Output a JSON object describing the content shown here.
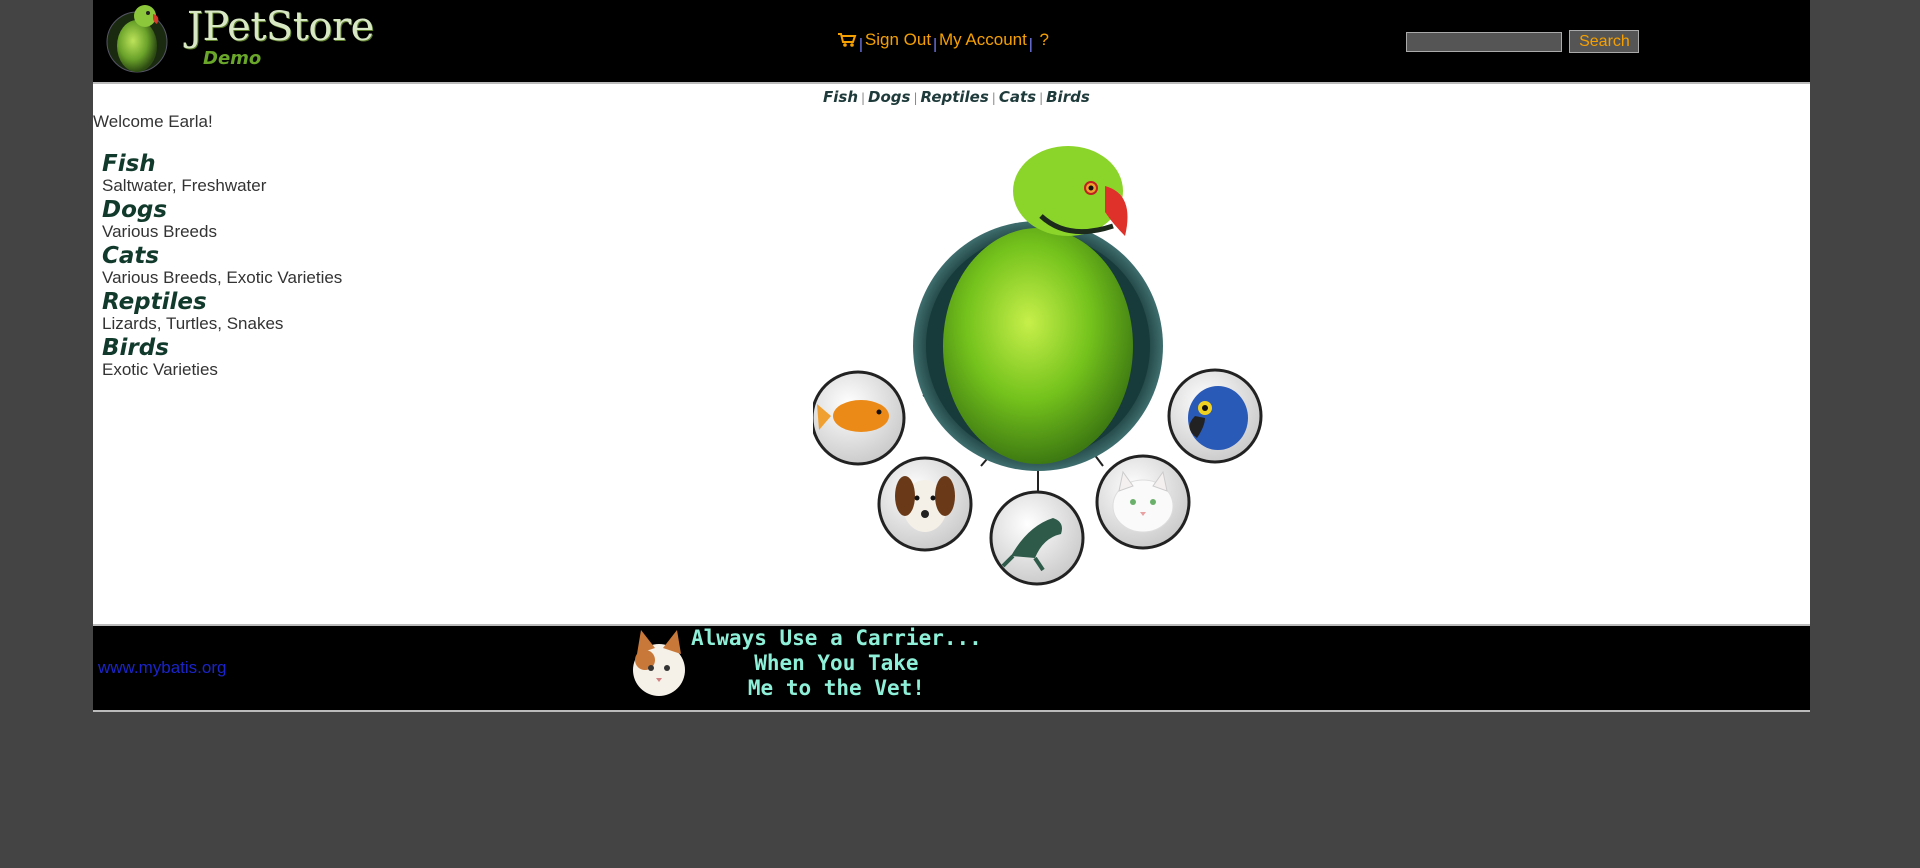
{
  "header": {
    "logo_title": "JPetStore",
    "logo_subtitle": "Demo",
    "menu": {
      "sign_out": "Sign Out",
      "my_account": "My Account",
      "help": "?",
      "separator": "|"
    },
    "search": {
      "placeholder": "",
      "button_label": "Search"
    },
    "colors": {
      "link": "#f5a000",
      "separator": "#7c84ff"
    }
  },
  "quick_links": [
    "Fish",
    "Dogs",
    "Reptiles",
    "Cats",
    "Birds"
  ],
  "quick_links_separator": "|",
  "welcome": "Welcome Earla!",
  "categories": [
    {
      "name": "Fish",
      "description": "Saltwater, Freshwater"
    },
    {
      "name": "Dogs",
      "description": "Various Breeds"
    },
    {
      "name": "Cats",
      "description": "Various Breeds, Exotic Varieties"
    },
    {
      "name": "Reptiles",
      "description": "Lizards, Turtles, Snakes"
    },
    {
      "name": "Birds",
      "description": "Exotic Varieties"
    }
  ],
  "footer": {
    "link": "www.mybatis.org",
    "banner_lines": [
      "Always Use a Carrier...",
      "When You Take",
      "Me to the Vet!"
    ]
  },
  "icons": {
    "cart": "cart-icon",
    "logo": "parrot-logo-icon"
  }
}
